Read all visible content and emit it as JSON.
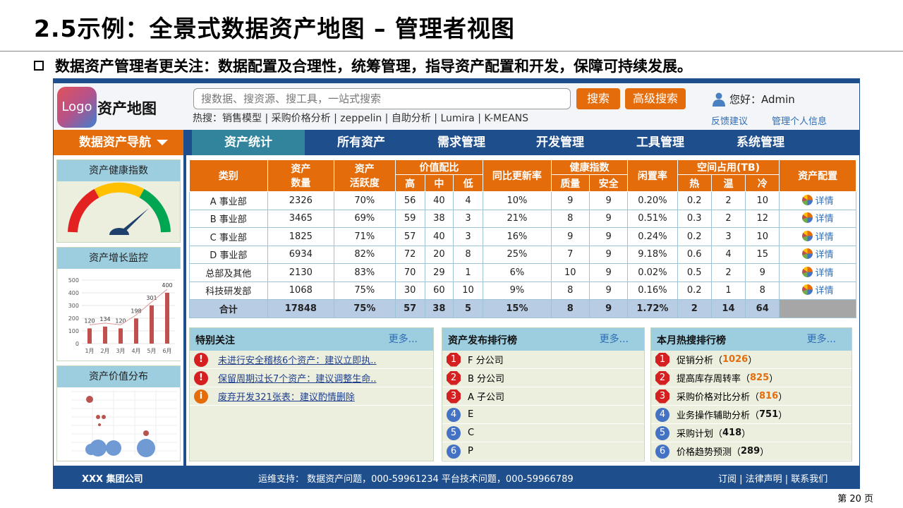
{
  "slide": {
    "title": "2.5示例：全景式数据资产地图 – 管理者视图",
    "subtitle": "数据资产管理者更关注：数据配置及合理性，统筹管理，指导资产配置和开发，保障可持续发展。",
    "page": "第 20 页"
  },
  "header": {
    "logo": "Logo",
    "app_title": "资产地图",
    "search_placeholder": "搜数据、搜资源、搜工具，一站式搜索",
    "search_button": "搜索",
    "advanced_button": "高级搜索",
    "hot_label": "热搜：",
    "hot_items": "销售模型 | 采购价格分析 | zeppelin | 自助分析 | Lumira | K-MEANS",
    "greeting": "您好：Admin",
    "feedback": "反馈建议",
    "manage_profile": "管理个人信息"
  },
  "nav": {
    "left": "数据资产导航",
    "tabs": [
      "资产统计",
      "所有资产",
      "需求管理",
      "开发管理",
      "工具管理",
      "系统管理"
    ]
  },
  "sidebar": {
    "health": "资产健康指数",
    "growth": "资产增长监控",
    "value": "资产价值分布"
  },
  "chart_data": [
    {
      "type": "bar",
      "categories": [
        "1月",
        "2月",
        "3月",
        "4月",
        "5月",
        "6月"
      ],
      "values": [
        120,
        134,
        120,
        198,
        301,
        400
      ],
      "ylim": [
        0,
        500
      ],
      "yticks": [
        "0",
        "100",
        "200",
        "300",
        "400",
        "500"
      ]
    }
  ],
  "table": {
    "headers": {
      "category": "类别",
      "asset_count": "资产\n数量",
      "activity": "资产\n活跃度",
      "value_ratio": "价值配比",
      "high": "高",
      "mid": "中",
      "low": "低",
      "yoy": "同比更新率",
      "health": "健康指数",
      "quality": "质量",
      "safety": "安全",
      "idle": "闲置率",
      "space": "空间占用(TB)",
      "hot": "热",
      "warm": "温",
      "cold": "冷",
      "config": "资产配置"
    },
    "detail_label": "详情",
    "rows": [
      [
        "A 事业部",
        "2326",
        "70%",
        "56",
        "40",
        "4",
        "10%",
        "9",
        "9",
        "0.20%",
        "0.2",
        "2",
        "10"
      ],
      [
        "B 事业部",
        "3465",
        "69%",
        "59",
        "38",
        "3",
        "21%",
        "8",
        "9",
        "0.51%",
        "0.3",
        "2",
        "12"
      ],
      [
        "C 事业部",
        "1825",
        "71%",
        "57",
        "40",
        "3",
        "16%",
        "9",
        "9",
        "0.24%",
        "0.2",
        "3",
        "10"
      ],
      [
        "D 事业部",
        "6934",
        "82%",
        "72",
        "20",
        "8",
        "25%",
        "7",
        "9",
        "9.18%",
        "0.6",
        "4",
        "15"
      ],
      [
        "总部及其他",
        "2130",
        "83%",
        "70",
        "29",
        "1",
        "6%",
        "10",
        "9",
        "0.02%",
        "0.5",
        "2",
        "9"
      ],
      [
        "科技研发部",
        "1068",
        "75%",
        "30",
        "60",
        "10",
        "9%",
        "8",
        "9",
        "0.16%",
        "0.2",
        "1",
        "8"
      ]
    ],
    "total": [
      "合计",
      "17848",
      "75%",
      "57",
      "38",
      "5",
      "15%",
      "8",
      "9",
      "1.72%",
      "2",
      "14",
      "64"
    ]
  },
  "attention": {
    "title": "特别关注",
    "more": "更多...",
    "items": [
      "未进行安全稽核6个资产：建议立即执..",
      "保留周期过长7个资产：建议调整生命..",
      "废弃开发321张表：建议酌情删除"
    ]
  },
  "publish": {
    "title": "资产发布排行榜",
    "more": "更多...",
    "items": [
      "F 分公司",
      "B 分公司",
      "A 子公司",
      "E",
      "C",
      "P"
    ]
  },
  "hot_search": {
    "title": "本月热搜排行榜",
    "more": "更多...",
    "items": [
      {
        "name": "促销分析（",
        "count": "1026",
        "end": "）"
      },
      {
        "name": "提高库存周转率（",
        "count": "825",
        "end": "）"
      },
      {
        "name": "采购价格对比分析（",
        "count": "816",
        "end": "）"
      },
      {
        "name": "业务操作辅助分析（",
        "count": "751",
        "end": "）"
      },
      {
        "name": "采购计划（",
        "count": "418",
        "end": "）"
      },
      {
        "name": "价格趋势预测（",
        "count": "289",
        "end": "）"
      }
    ]
  },
  "footer": {
    "company": "XXX 集团公司",
    "support": "运维支持：  数据资产问题，000-59961234   平台技术问题，000-59966789",
    "links": "订阅  | 法律声明 | 联系我们"
  }
}
